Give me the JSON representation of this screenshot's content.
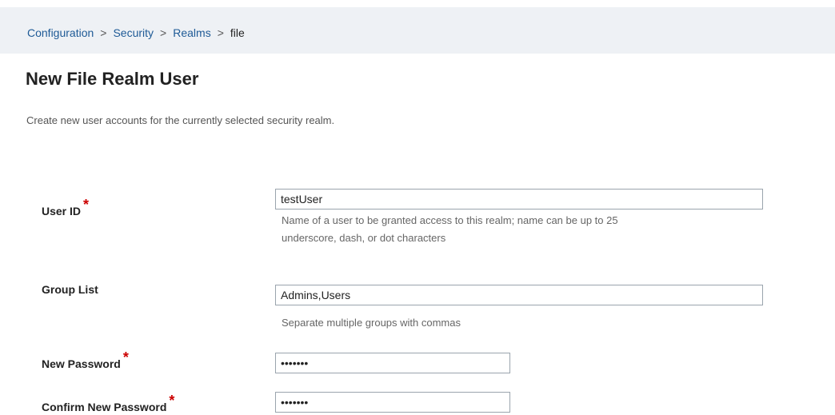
{
  "breadcrumb": {
    "items": [
      "Configuration",
      "Security",
      "Realms"
    ],
    "separator": ">",
    "current": "file"
  },
  "page": {
    "title": "New File Realm User",
    "description": "Create new user accounts for the currently selected security realm."
  },
  "form": {
    "required_marker": "*",
    "user_id": {
      "label": "User ID",
      "value": "testUser",
      "help_line1": "Name of a user to be granted access to this realm; name can be up to 25",
      "help_line2": "underscore, dash, or dot characters"
    },
    "group_list": {
      "label": "Group List",
      "value": "Admins,Users",
      "help": "Separate multiple groups with commas"
    },
    "new_password": {
      "label": "New Password",
      "value": "•••••••"
    },
    "confirm_password": {
      "label": "Confirm New Password",
      "value": "•••••••"
    }
  },
  "colors": {
    "link": "#1e5a96",
    "required": "#cc0000",
    "breadcrumb_bg": "#eef1f5"
  }
}
